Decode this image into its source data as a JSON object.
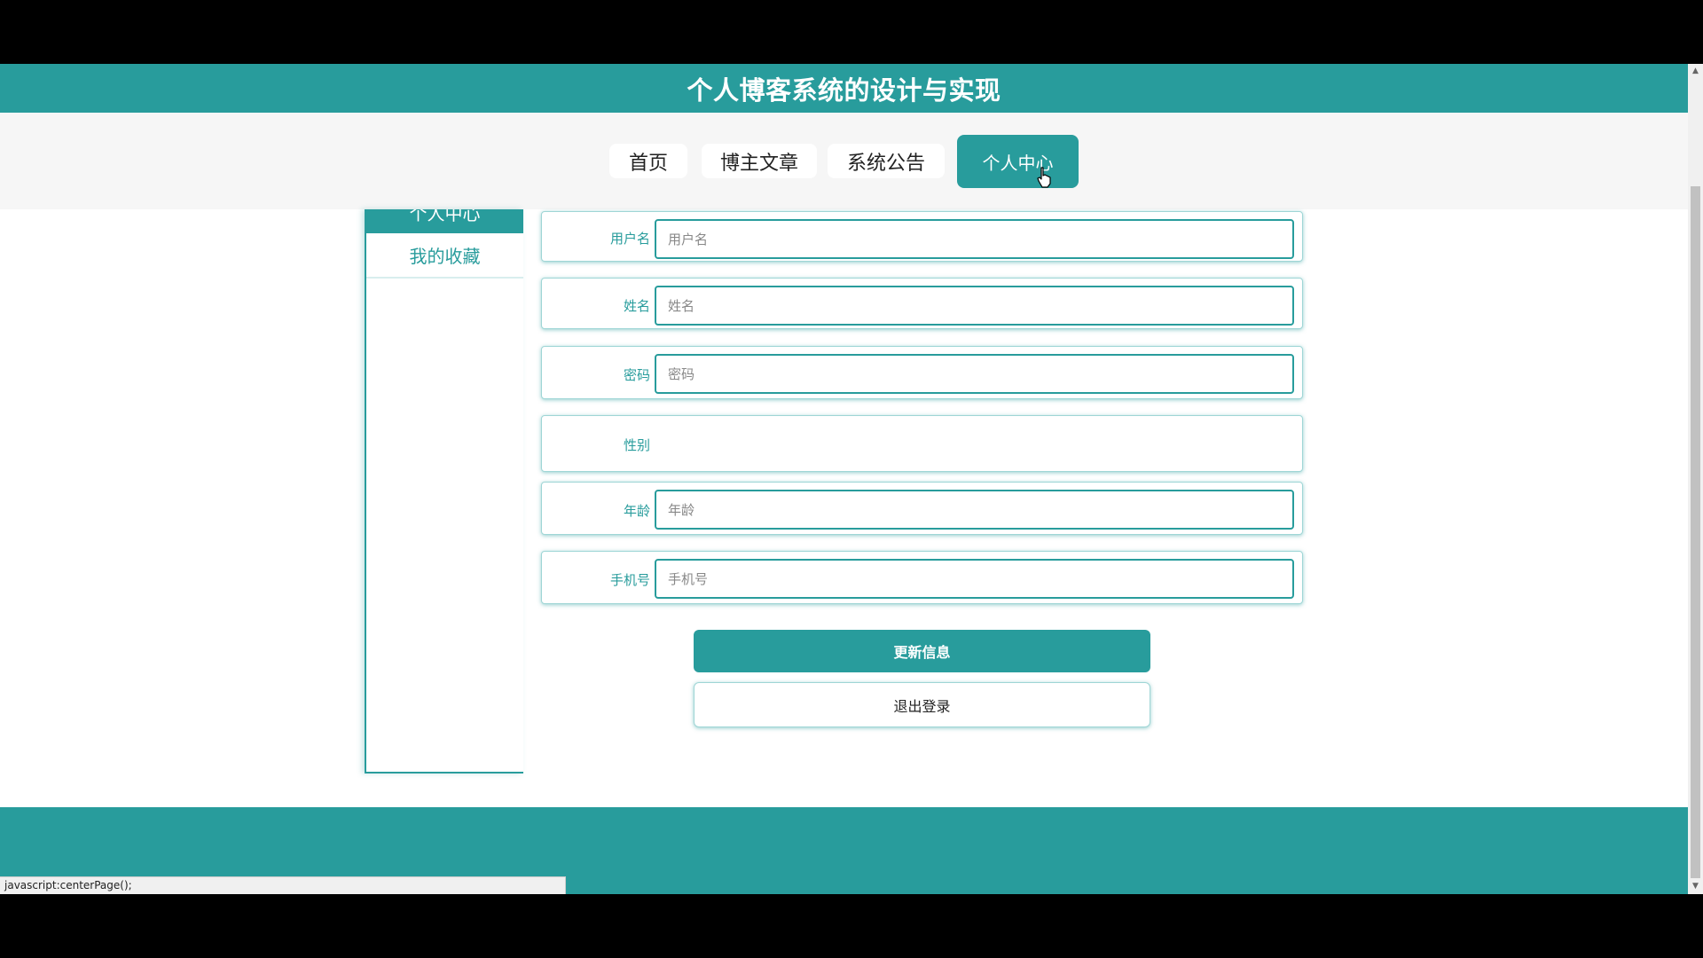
{
  "header": {
    "title": "个人博客系统的设计与实现"
  },
  "nav": {
    "items": [
      {
        "label": "首页"
      },
      {
        "label": "博主文章"
      },
      {
        "label": "系统公告"
      },
      {
        "label": "个人中心"
      }
    ],
    "active_index": 3
  },
  "sidebar": {
    "heading": "个人中心",
    "items": [
      {
        "label": "我的收藏"
      }
    ]
  },
  "form": {
    "fields": [
      {
        "label": "用户名",
        "value": "",
        "placeholder": "用户名"
      },
      {
        "label": "姓名",
        "value": "",
        "placeholder": "姓名"
      },
      {
        "label": "密码",
        "value": "",
        "placeholder": "密码"
      },
      {
        "label": "性别"
      },
      {
        "label": "年龄",
        "value": "",
        "placeholder": "年龄"
      },
      {
        "label": "手机号",
        "value": "",
        "placeholder": "手机号"
      }
    ],
    "update_label": "更新信息",
    "logout_label": "退出登录"
  },
  "status_bar": {
    "url": "javascript:centerPage();"
  },
  "colors": {
    "accent": "#289c9c",
    "nav_background": "#f6f6f6"
  },
  "icons": {
    "cursor": "hand-pointer-icon",
    "scroll_up": "scroll-up-arrow-icon",
    "scroll_down": "scroll-down-arrow-icon"
  }
}
